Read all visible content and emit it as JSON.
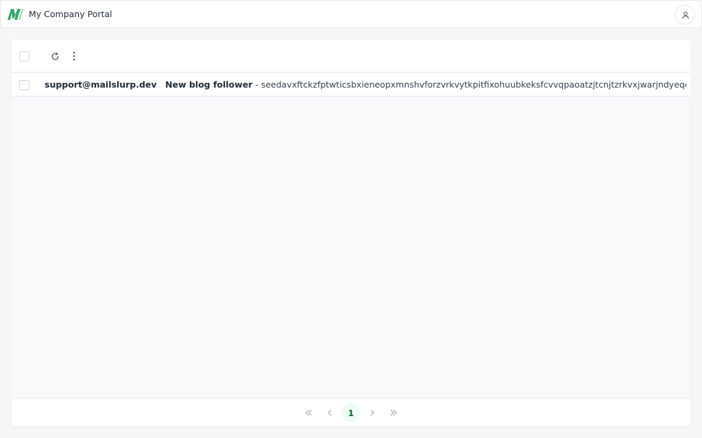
{
  "header": {
    "app_title": "My Company Portal",
    "logo_icon": "mailslurp-logo",
    "brand_color": "#34a866",
    "user_icon": "user-icon"
  },
  "toolbar": {
    "refresh_icon": "refresh-icon",
    "more_icon": "more-vertical-icon"
  },
  "inbox": {
    "emails": [
      {
        "sender": "support@mailslurp.dev",
        "subject": "New blog follower",
        "separator": " - ",
        "preview": "seedavxftckzfptwticsbxieneopxmnshvforzvrkvytkpitfixohuubkeksfcvvqpaoatzjtcnjtzrkvxjwarjndyeqegnfimkj"
      }
    ]
  },
  "pagination": {
    "current_page": "1",
    "first_icon": "chevrons-left-icon",
    "prev_icon": "chevron-left-icon",
    "next_icon": "chevron-right-icon",
    "last_icon": "chevrons-right-icon",
    "active_color": "#ecfdf3"
  }
}
